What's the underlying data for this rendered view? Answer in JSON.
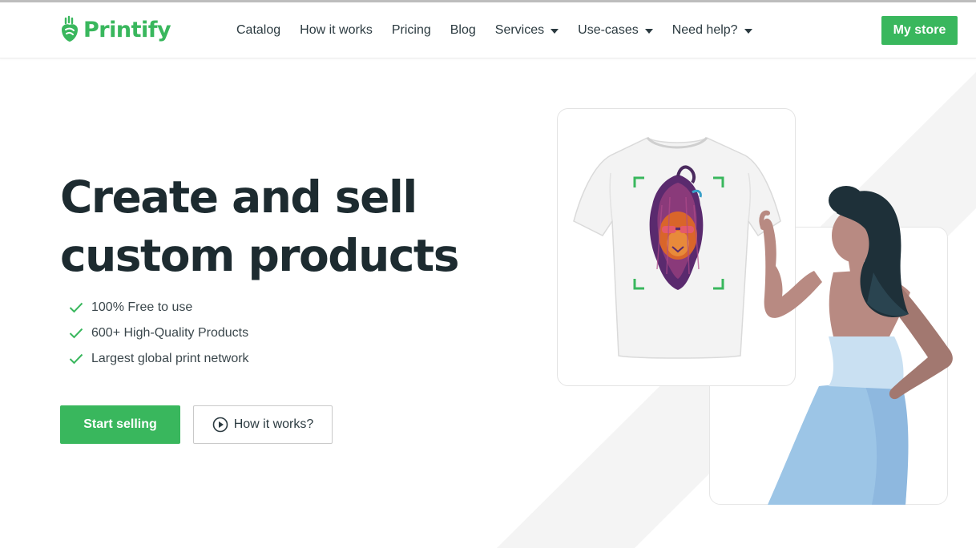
{
  "brand": {
    "name": "Printify",
    "color": "#39b75d",
    "icon": "printify-logo-icon"
  },
  "nav": {
    "items": [
      {
        "label": "Catalog",
        "dropdown": false
      },
      {
        "label": "How it works",
        "dropdown": false
      },
      {
        "label": "Pricing",
        "dropdown": false
      },
      {
        "label": "Blog",
        "dropdown": false
      },
      {
        "label": "Services",
        "dropdown": true
      },
      {
        "label": "Use-cases",
        "dropdown": true
      },
      {
        "label": "Need help?",
        "dropdown": true
      }
    ],
    "cta": "My store"
  },
  "hero": {
    "title_line1": "Create and sell",
    "title_line2": "custom products",
    "features": [
      "100% Free to use",
      "600+ High-Quality Products",
      "Largest global print network"
    ],
    "primary_button": "Start selling",
    "secondary_button": "How it works?",
    "secondary_icon": "play-circle-icon",
    "feature_icon": "checkmark-icon"
  },
  "illustration": {
    "product": "t-shirt-with-lion-print",
    "person": "woman-pointing-illustration"
  },
  "colors": {
    "accent": "#39b75d",
    "text": "#1d2b30",
    "woman_hair": "#1e3039",
    "woman_skin": "#b88a82",
    "woman_dress": "#9cc5e6"
  }
}
